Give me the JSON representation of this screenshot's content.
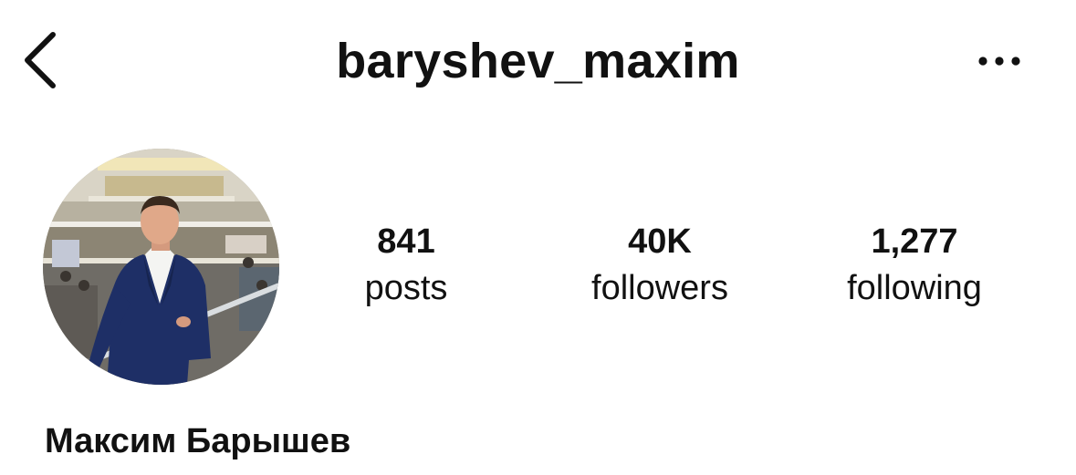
{
  "header": {
    "back_icon": "chevron-left-icon",
    "username": "baryshev_maxim",
    "more_icon": "ellipsis-horizontal-icon"
  },
  "profile": {
    "avatar": "profile-photo",
    "stats": [
      {
        "value": "841",
        "label": "posts"
      },
      {
        "value": "40K",
        "label": "followers"
      },
      {
        "value": "1,277",
        "label": "following"
      }
    ],
    "display_name": "Максим Барышев"
  },
  "colors": {
    "text": "#111111",
    "background": "#ffffff"
  }
}
